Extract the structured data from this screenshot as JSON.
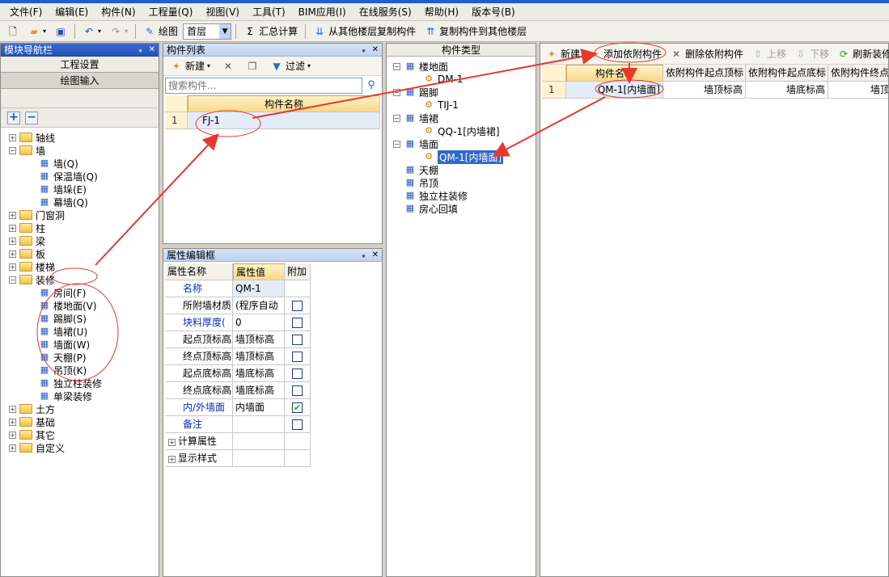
{
  "menu": [
    "文件(F)",
    "编辑(E)",
    "构件(N)",
    "工程量(Q)",
    "视图(V)",
    "工具(T)",
    "BIM应用(I)",
    "在线服务(S)",
    "帮助(H)",
    "版本号(B)"
  ],
  "toolbar": {
    "draw_label": "绘图",
    "floor_value": "首层",
    "sum_label": "汇总计算",
    "copy_from_label": "从其他楼层复制构件",
    "copy_to_label": "复制构件到其他楼层"
  },
  "nav": {
    "title": "模块导航栏",
    "btn_project": "工程设置",
    "btn_draw": "绘图输入",
    "tree": [
      {
        "label": "轴线",
        "type": "folder"
      },
      {
        "label": "墙",
        "type": "folder"
      },
      {
        "label": "墙(Q)",
        "type": "leaf"
      },
      {
        "label": "保温墙(Q)",
        "type": "leaf"
      },
      {
        "label": "墙垛(E)",
        "type": "leaf"
      },
      {
        "label": "幕墙(Q)",
        "type": "leaf"
      },
      {
        "label": "门窗洞",
        "type": "folder"
      },
      {
        "label": "柱",
        "type": "folder"
      },
      {
        "label": "梁",
        "type": "folder"
      },
      {
        "label": "板",
        "type": "folder"
      },
      {
        "label": "楼梯",
        "type": "folder"
      },
      {
        "label": "装修",
        "type": "folder"
      },
      {
        "label": "房间(F)",
        "type": "leaf"
      },
      {
        "label": "楼地面(V)",
        "type": "leaf"
      },
      {
        "label": "踢脚(S)",
        "type": "leaf"
      },
      {
        "label": "墙裙(U)",
        "type": "leaf"
      },
      {
        "label": "墙面(W)",
        "type": "leaf"
      },
      {
        "label": "天棚(P)",
        "type": "leaf"
      },
      {
        "label": "吊顶(K)",
        "type": "leaf"
      },
      {
        "label": "独立柱装修",
        "type": "leaf"
      },
      {
        "label": "单梁装修",
        "type": "leaf"
      },
      {
        "label": "土方",
        "type": "folder"
      },
      {
        "label": "基础",
        "type": "folder"
      },
      {
        "label": "其它",
        "type": "folder"
      },
      {
        "label": "自定义",
        "type": "folder"
      }
    ]
  },
  "component_list": {
    "title": "构件列表",
    "new_label": "新建",
    "filter_label": "过滤",
    "search_placeholder": "搜索构件...",
    "col_name": "构件名称",
    "rows": [
      {
        "num": "1",
        "name": "FJ-1"
      }
    ]
  },
  "props": {
    "title": "属性编辑框",
    "col_name": "属性名称",
    "col_value": "属性值",
    "col_extra": "附加",
    "rows": [
      {
        "name": "名称",
        "value": "QM-1"
      },
      {
        "name": "所附墙材质",
        "value": "(程序自动"
      },
      {
        "name": "块料厚度(",
        "value": "0"
      },
      {
        "name": "起点顶标高",
        "value": "墙顶标高"
      },
      {
        "name": "终点顶标高",
        "value": "墙顶标高"
      },
      {
        "name": "起点底标高",
        "value": "墙底标高"
      },
      {
        "name": "终点底标高",
        "value": "墙底标高"
      },
      {
        "name": "内/外墙面",
        "value": "内墙面"
      },
      {
        "name": "备注",
        "value": ""
      },
      {
        "name": "计算属性",
        "value": ""
      },
      {
        "name": "显示样式",
        "value": ""
      }
    ]
  },
  "type_panel": {
    "title": "构件类型",
    "tree": [
      {
        "label": "楼地面",
        "level": 0
      },
      {
        "label": "DM-1",
        "level": 1
      },
      {
        "label": "踢脚",
        "level": 0
      },
      {
        "label": "TIJ-1",
        "level": 1
      },
      {
        "label": "墙裙",
        "level": 0
      },
      {
        "label": "QQ-1[内墙裙]",
        "level": 1
      },
      {
        "label": "墙面",
        "level": 0
      },
      {
        "label": "QM-1[内墙面]",
        "level": 1
      },
      {
        "label": "天棚",
        "level": 0
      },
      {
        "label": "吊顶",
        "level": 0
      },
      {
        "label": "独立柱装修",
        "level": 0
      },
      {
        "label": "房心回填",
        "level": 0
      }
    ]
  },
  "attach": {
    "new_label": "新建",
    "add_label": "添加依附构件",
    "delete_label": "删除依附构件",
    "up_label": "上移",
    "down_label": "下移",
    "refresh_label": "刷新装修图",
    "headers": [
      "构件名称",
      "依附构件起点顶标",
      "依附构件起点底标",
      "依附构件终点"
    ],
    "rows": [
      {
        "num": "1",
        "name": "QM-1[内墙面]",
        "c1": "墙顶标高",
        "c2": "墙底标高",
        "c3": "墙顶"
      }
    ]
  }
}
